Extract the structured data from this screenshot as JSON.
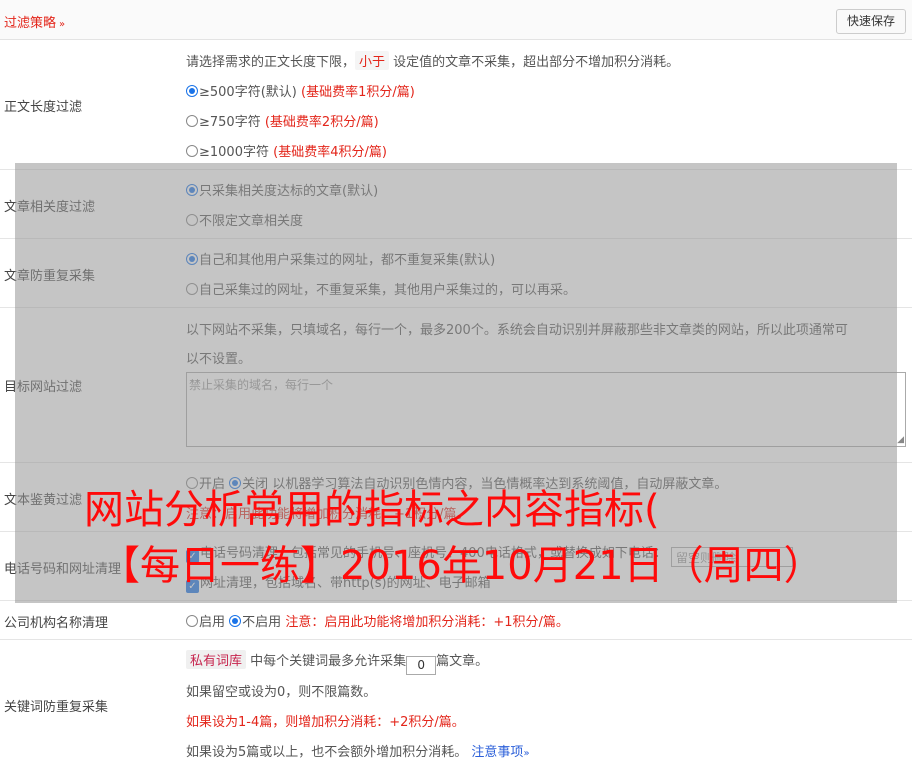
{
  "header": {
    "title": "过滤策略",
    "chevron": "»",
    "quick_save": "快速保存"
  },
  "length_filter": {
    "label": "正文长度过滤",
    "desc_pre": "请选择需求的正文长度下限，",
    "desc_tag": "小于",
    "desc_post": "设定值的文章不采集，超出部分不增加积分消耗。",
    "options": [
      {
        "text": "≥500字符(默认)",
        "note": "(基础费率1积分/篇)",
        "selected": true
      },
      {
        "text": "≥750字符",
        "note": "(基础费率2积分/篇)",
        "selected": false
      },
      {
        "text": "≥1000字符",
        "note": "(基础费率4积分/篇)",
        "selected": false
      }
    ]
  },
  "relevance": {
    "label": "文章相关度过滤",
    "options": [
      {
        "text": "只采集相关度达标的文章(默认)",
        "selected": true
      },
      {
        "text": "不限定文章相关度",
        "selected": false
      }
    ]
  },
  "dedupe": {
    "label": "文章防重复采集",
    "options": [
      {
        "text": "自己和其他用户采集过的网址，都不重复采集(默认)",
        "selected": true
      },
      {
        "text": "自己采集过的网址，不重复采集，其他用户采集过的，可以再采。",
        "selected": false
      }
    ]
  },
  "site_filter": {
    "label": "目标网站过滤",
    "desc_line1": "以下网站不采集，只填域名，每行一个，最多200个。系统会自动识别并屏蔽那些非文章类的网站，所以此项通常可",
    "desc_line2": "以不设置。",
    "placeholder": "禁止采集的域名，每行一个"
  },
  "porn_filter": {
    "label": "文本鉴黄过滤",
    "option_on": "开启",
    "option_off": "关闭",
    "desc": "以机器学习算法自动识别色情内容，当色情概率达到系统阈值，自动屏蔽文章。",
    "note": "注意：启用此功能将增加积分消耗：+1积分/篇。"
  },
  "contact_clean": {
    "label": "电话号码和网址清理",
    "phone_text": "电话号码清理，包括常见的手机号、座机号、400电话格式，或替换成如下电话：",
    "phone_placeholder": "留空则删除",
    "url_text": "网址清理，包括域名、带http(s)的网址、电子邮箱"
  },
  "company_clean": {
    "label": "公司机构名称清理",
    "option_on": "启用",
    "option_off": "不启用",
    "note": "注意：启用此功能将增加积分消耗：+1积分/篇。"
  },
  "keyword_dedupe": {
    "label": "关键词防重复采集",
    "tag": "私有词库",
    "line1_pre": "中每个关键词最多允许采集",
    "value": "0",
    "line1_post": "篇文章。",
    "line2": "如果留空或设为0，则不限篇数。",
    "line3": "如果设为1-4篇，则增加积分消耗：+2积分/篇。",
    "line4": "如果设为5篇或以上，也不会额外增加积分消耗。",
    "link": "注意事项",
    "link_chevron": "»"
  },
  "watermark": {
    "line1": "网站分析常用的指标之内容指标(",
    "line2": "【每日一练】2016年10月21日（周四）"
  },
  "colors": {
    "accent_red": "#e3261b",
    "accent_blue": "#1a73e8",
    "link_blue": "#2b5fd9",
    "watermark": "#ff0a0a"
  }
}
